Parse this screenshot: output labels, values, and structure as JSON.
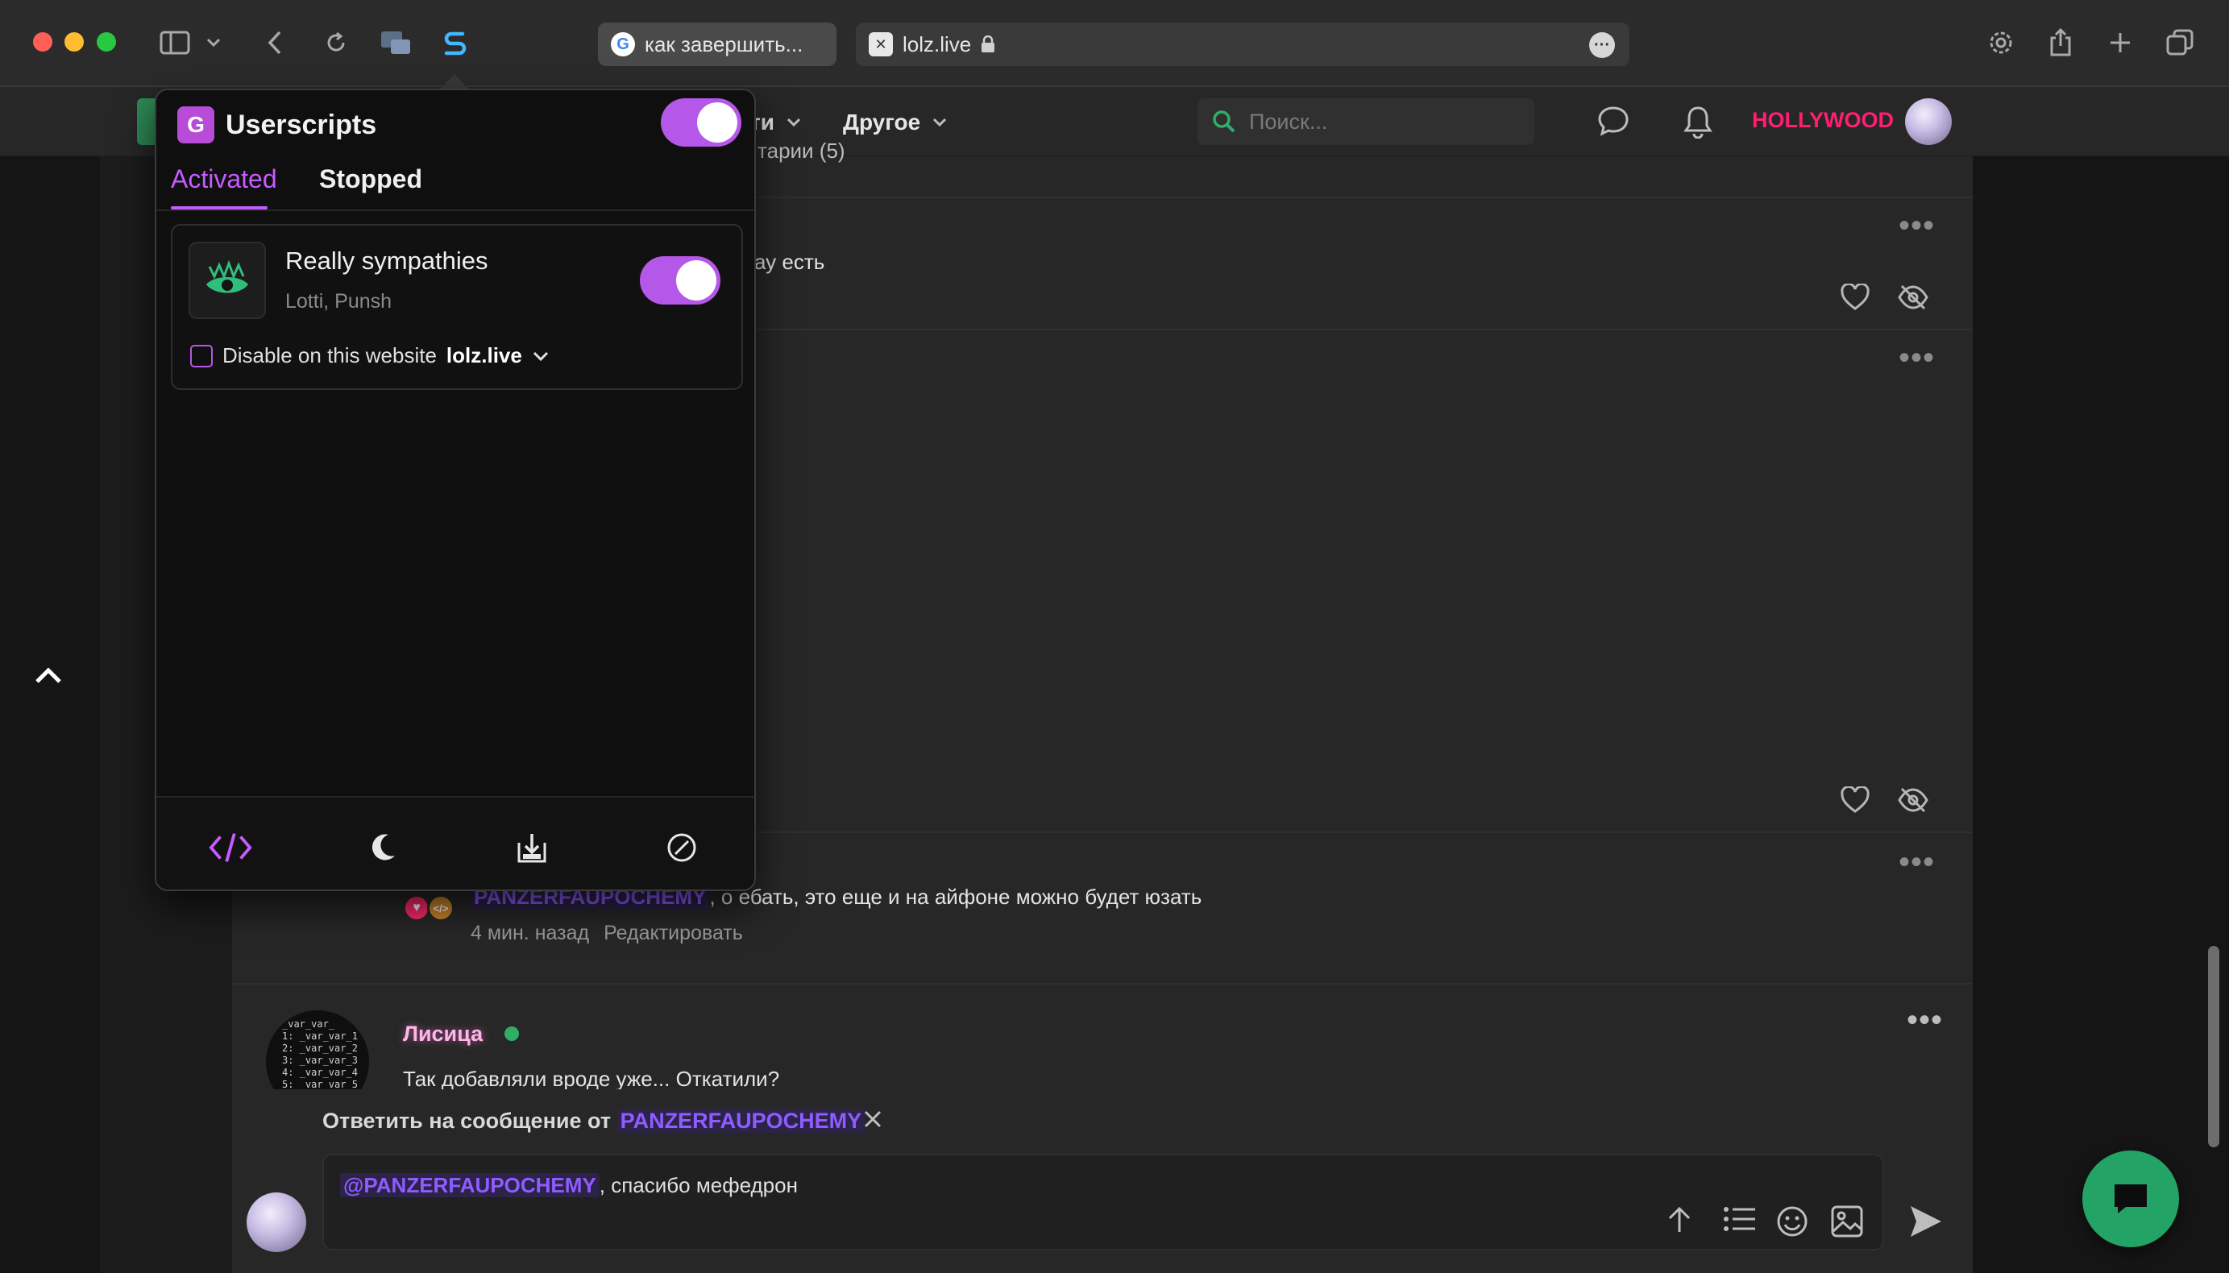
{
  "browser": {
    "tabs": [
      {
        "label": "как завершить..."
      },
      {
        "label": "lolz.live"
      }
    ]
  },
  "header": {
    "nav_partial": "ти",
    "nav_other": "Другое",
    "search_placeholder": "Поиск...",
    "username": "HOLLYWOOD",
    "username_color": "#ff1f6e"
  },
  "feed": {
    "partial_text_top": "тарии (5)",
    "partial_text_comment": "ау есть",
    "reply_comment": {
      "mention": "PANZERFAUPOCHEMY",
      "text": ", о ебать, это еще и на айфоне можно будет юзать",
      "time": "4 мин. назад",
      "edit": "Редактировать"
    },
    "last_comment": {
      "author": "Лисица",
      "text": "Так добавляли вроде уже... Откатили?",
      "avatar_lines": [
        "_var_var_",
        "1: _var_var_1",
        "2: _var_var_2",
        "3: _var_var_3",
        "4: _var_var_4",
        "5: _var_var_5"
      ]
    }
  },
  "composer": {
    "reply_prefix": "Ответить на сообщение от",
    "reply_user": "PANZERFAUPOCHEMY",
    "mention": "@PANZERFAUPOCHEMY",
    "text": ", спасибо мефедрон"
  },
  "popover": {
    "title": "Userscripts",
    "logo_letter": "G",
    "tabs": {
      "activated": "Activated",
      "stopped": "Stopped"
    },
    "script": {
      "name": "Really sympathies",
      "authors": "Lotti, Punsh",
      "disable_label": "Disable on this website",
      "host": "lolz.live"
    },
    "accent_color": "#b557e8"
  }
}
